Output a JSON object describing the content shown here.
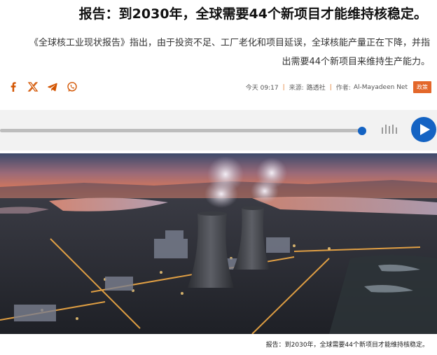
{
  "article": {
    "headline": "报告：到2030年，全球需要44个新项目才能维持核稳定。",
    "summary": "《全球核工业现状报告》指出，由于投资不足、工厂老化和项目延误，全球核能产量正在下降，并指出需要44个新项目来维持生产能力。"
  },
  "share": {
    "icons": [
      "facebook-icon",
      "x-icon",
      "telegram-icon",
      "whatsapp-icon"
    ],
    "accent_color": "#d35400"
  },
  "meta": {
    "time": "今天 09:17",
    "source_label": "来源:",
    "source_value": "路透社",
    "author_label": "作者:",
    "author_value": "Al-Mayadeen Net",
    "tag": "政策",
    "tag_color": "#e3672a"
  },
  "audio": {
    "progress": 1.0,
    "play_color": "#1463c3"
  },
  "caption": "报告：到2030年，全球需要44个新项目才能维持核稳定。"
}
